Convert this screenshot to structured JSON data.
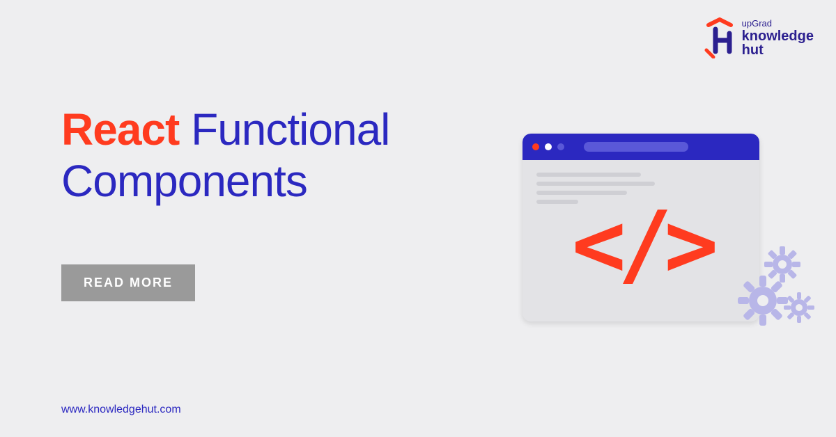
{
  "logo": {
    "upgrad": "upGrad",
    "knowledge": "knowledge",
    "hut": "hut"
  },
  "headline": {
    "accent": "React",
    "rest1": "Functional",
    "rest2": "Components"
  },
  "cta": {
    "label": "READ MORE"
  },
  "footer": {
    "url": "www.knowledgehut.com"
  },
  "illustration": {
    "code_symbol": "</>"
  },
  "colors": {
    "accent_red": "#ff3b1f",
    "brand_blue": "#2b28c0",
    "button_gray": "#9a9a9a",
    "bg": "#eeeef0"
  }
}
